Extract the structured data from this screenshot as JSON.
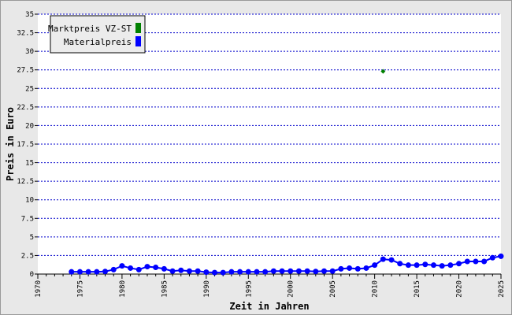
{
  "chart_data": {
    "type": "line",
    "xlabel": "Zeit in Jahren",
    "ylabel": "Preis in Euro",
    "xlim": [
      1970,
      2025
    ],
    "ylim": [
      0,
      35
    ],
    "x_ticks": [
      "1970",
      "1975",
      "1980",
      "1985",
      "1990",
      "1995",
      "2000",
      "2005",
      "2010",
      "2015",
      "2020",
      "2025"
    ],
    "y_ticks": [
      "0",
      "2.5",
      "5",
      "7.5",
      "10",
      "12.5",
      "15",
      "17.5",
      "20",
      "22.5",
      "25",
      "27.5",
      "30",
      "32.5",
      "35"
    ],
    "grid": true,
    "legend_position": "top-left",
    "series": [
      {
        "name": "Marktpreis VZ-ST",
        "color": "#008000",
        "marker": "diamond",
        "x": [
          2011
        ],
        "values": [
          27.3
        ]
      },
      {
        "name": "Materialpreis",
        "color": "#0000ff",
        "marker": "circle",
        "x": [
          1974,
          1975,
          1976,
          1977,
          1978,
          1979,
          1980,
          1981,
          1982,
          1983,
          1984,
          1985,
          1986,
          1987,
          1988,
          1989,
          1990,
          1991,
          1992,
          1993,
          1994,
          1995,
          1996,
          1997,
          1998,
          1999,
          2000,
          2001,
          2002,
          2003,
          2004,
          2005,
          2006,
          2007,
          2008,
          2009,
          2010,
          2011,
          2012,
          2013,
          2014,
          2015,
          2016,
          2017,
          2018,
          2019,
          2020,
          2021,
          2022,
          2023,
          2024,
          2025
        ],
        "values": [
          0.3,
          0.3,
          0.3,
          0.3,
          0.35,
          0.6,
          1.1,
          0.8,
          0.6,
          1.0,
          0.9,
          0.7,
          0.4,
          0.5,
          0.4,
          0.4,
          0.25,
          0.2,
          0.2,
          0.3,
          0.3,
          0.3,
          0.3,
          0.3,
          0.4,
          0.4,
          0.4,
          0.4,
          0.4,
          0.35,
          0.4,
          0.4,
          0.7,
          0.8,
          0.7,
          0.8,
          1.2,
          2.0,
          1.9,
          1.4,
          1.2,
          1.2,
          1.3,
          1.2,
          1.1,
          1.2,
          1.4,
          1.7,
          1.7,
          1.7,
          2.2,
          2.4
        ]
      }
    ]
  }
}
